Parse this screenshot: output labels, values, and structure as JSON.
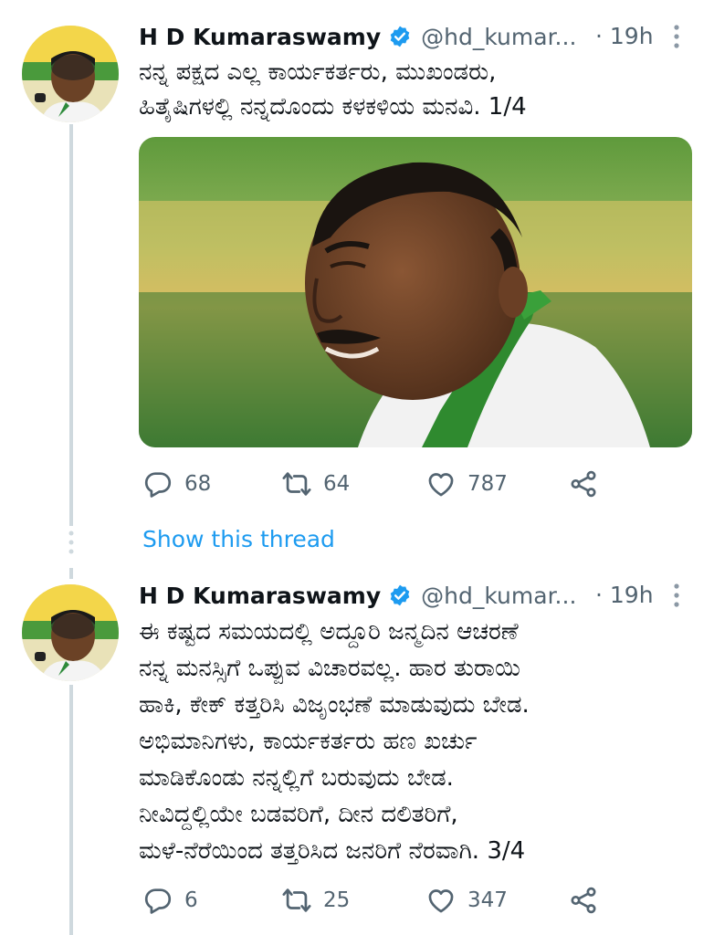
{
  "tweets": [
    {
      "name": "H D Kumaraswamy",
      "handle": "@hd_kumar...",
      "time": "· 19h",
      "text": "ನನ್ನ ಪಕ್ಷದ ಎಲ್ಲ ಕಾರ್ಯಕರ್ತರು, ಮುಖಂಡರು,\nಹಿತೈಷಿಗಳಲ್ಲಿ ನನ್ನದೊಂದು ಕಳಕಳಿಯ ಮನವಿ. 1/4",
      "replies": "68",
      "retweets": "64",
      "likes": "787"
    },
    {
      "name": "H D Kumaraswamy",
      "handle": "@hd_kumar...",
      "time": "· 19h",
      "text": "ಈ ಕಷ್ಟದ ಸಮಯದಲ್ಲಿ ಅದ್ದೂರಿ ಜನ್ಮದಿನ ಆಚರಣೆ\nನನ್ನ ಮನಸ್ಸಿಗೆ ಒಪ್ಪುವ ವಿಚಾರವಲ್ಲ. ಹಾರ ತುರಾಯಿ\nಹಾಕಿ, ಕೇಕ್ ಕತ್ತರಿಸಿ ವಿಜೃಂಭಣೆ ಮಾಡುವುದು ಬೇಡ.\nಅಭಿಮಾನಿಗಳು, ಕಾರ್ಯಕರ್ತರು ಹಣ ಖರ್ಚು\nಮಾಡಿಕೊಂಡು ನನ್ನಲ್ಲಿಗೆ ಬರುವುದು ಬೇಡ.\nನೀವಿದ್ದಲ್ಲಿಯೇ ಬಡವರಿಗೆ, ದೀನ ದಲಿತರಿಗೆ,\nಮಳೆ-ನೆರೆಯಿಂದ ತತ್ತರಿಸಿದ ಜನರಿಗೆ ನೆರವಾಗಿ. 3/4",
      "replies": "6",
      "retweets": "25",
      "likes": "347"
    }
  ],
  "show_thread_label": "Show this thread",
  "colors": {
    "link": "#1d9bf0",
    "muted": "#536471",
    "verified": "#1d9bf0",
    "thread_line": "#cfd9de"
  },
  "icons": [
    "reply-icon",
    "retweet-icon",
    "like-icon",
    "share-icon",
    "verified-badge-icon",
    "more-options-icon"
  ]
}
